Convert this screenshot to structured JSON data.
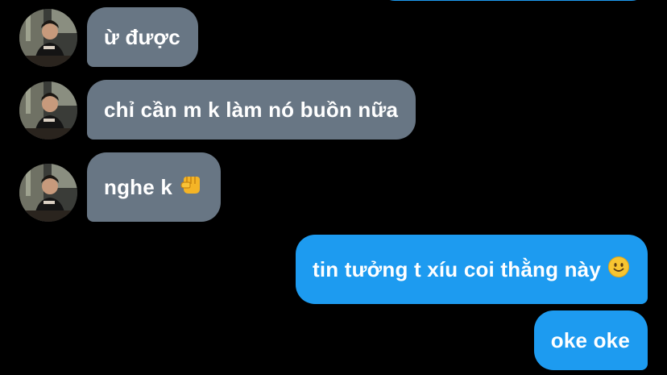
{
  "conversation": {
    "colors": {
      "background": "#000000",
      "incoming_bubble": "#687684",
      "outgoing_bubble": "#1d9bf0",
      "text": "#ffffff"
    },
    "messages": [
      {
        "direction": "incoming",
        "text": "ừ được"
      },
      {
        "direction": "incoming",
        "text": "chỉ cần m k làm nó buồn nữa"
      },
      {
        "direction": "incoming",
        "text": "nghe k",
        "emoji": "fist-bump-emoji"
      },
      {
        "direction": "outgoing",
        "text": "tin tưởng t xíu coi thằng này",
        "emoji": "slightly-smiling-face-emoji"
      },
      {
        "direction": "outgoing",
        "text": "oke oke"
      }
    ]
  }
}
